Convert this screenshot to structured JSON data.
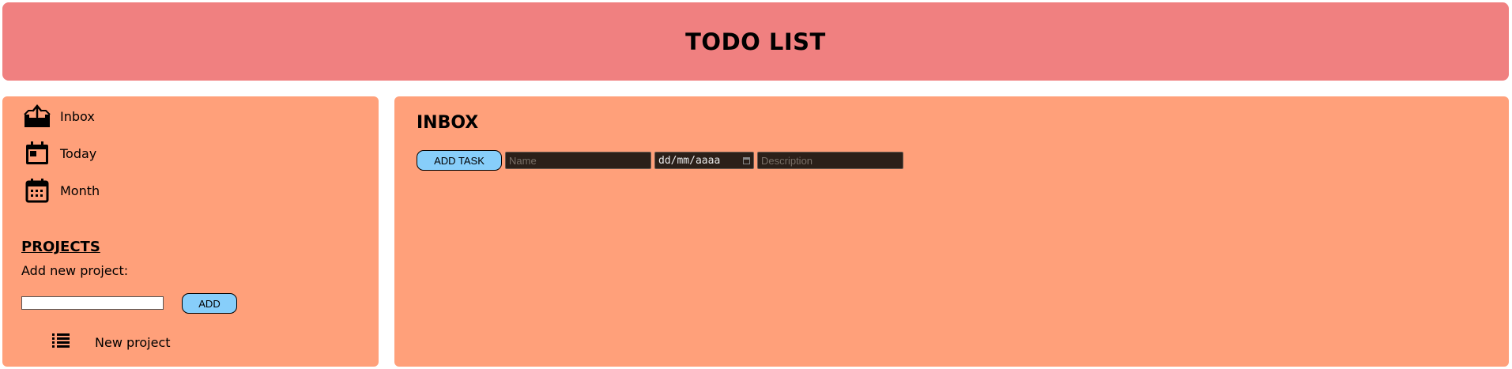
{
  "header": {
    "title": "TODO LIST"
  },
  "sidebar": {
    "nav": [
      {
        "label": "Inbox",
        "icon": "inbox-icon"
      },
      {
        "label": "Today",
        "icon": "calendar-day-icon"
      },
      {
        "label": "Month",
        "icon": "calendar-month-icon"
      }
    ],
    "projects_title": "PROJECTS",
    "add_project_label": "Add new project:",
    "add_button_label": "ADD",
    "project_input_value": "",
    "projects": [
      {
        "label": "New project",
        "icon": "list-icon"
      }
    ]
  },
  "main": {
    "title": "INBOX",
    "add_task_label": "ADD TASK",
    "name_placeholder": "Name",
    "date_placeholder": "dd/mm/aaaa",
    "description_placeholder": "Description"
  },
  "colors": {
    "header_bg": "#f08080",
    "panel_bg": "#ffa07a",
    "button_bg": "#87cefa",
    "input_dark_bg": "#2b2019"
  }
}
